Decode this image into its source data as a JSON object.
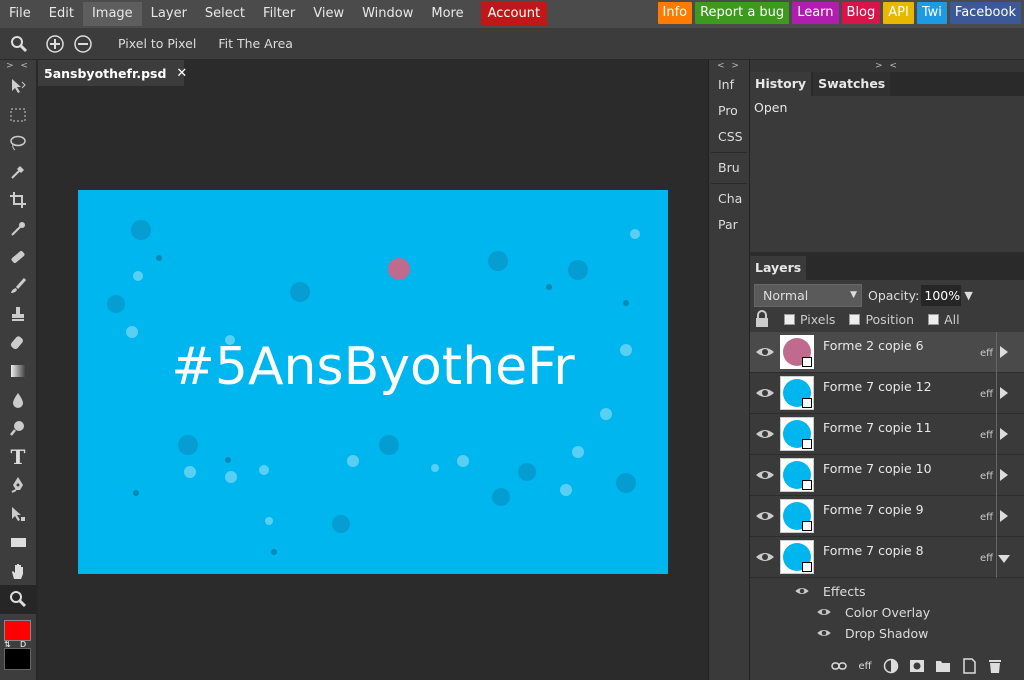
{
  "menubar": {
    "items": [
      "File",
      "Edit",
      "Image",
      "Layer",
      "Select",
      "Filter",
      "View",
      "Window",
      "More"
    ],
    "account": "Account",
    "badges": [
      {
        "label": "Info",
        "color": "#ff7a00"
      },
      {
        "label": "Report a bug",
        "color": "#3d9a1f"
      },
      {
        "label": "Learn",
        "color": "#b01eb0"
      },
      {
        "label": "Blog",
        "color": "#d8154a"
      },
      {
        "label": "API",
        "color": "#e8b800"
      },
      {
        "label": "Twi",
        "color": "#1c9be3"
      },
      {
        "label": "Facebook",
        "color": "#3b5998"
      }
    ]
  },
  "options": {
    "pixel_to_pixel": "Pixel to Pixel",
    "fit_area": "Fit The Area"
  },
  "toolbar": {
    "collapse": "> <",
    "swap": "⇅",
    "default": "D"
  },
  "document": {
    "tab_title": "5ansbyothefr.psd",
    "close": "✕",
    "headline": "#5AnsByotheFr",
    "canvas_color": "#00b6ee"
  },
  "midpanel": {
    "collapse": "< >",
    "items": [
      "Inf",
      "Pro",
      "CSS",
      "Bru",
      "Cha",
      "Par"
    ]
  },
  "history": {
    "collapse": "> <",
    "tabs": [
      "History",
      "Swatches"
    ],
    "entries": [
      "Open"
    ]
  },
  "layers": {
    "tab": "Layers",
    "blend_mode": "Normal",
    "opacity_label": "Opacity:",
    "opacity_value": "100%",
    "lock_options": [
      "Pixels",
      "Position",
      "All"
    ],
    "rows": [
      {
        "name": "Forme 2 copie 6",
        "color": "#c06b8e"
      },
      {
        "name": "Forme 7 copie 12",
        "color": "#00b6ee"
      },
      {
        "name": "Forme 7 copie 11",
        "color": "#00b6ee"
      },
      {
        "name": "Forme 7 copie 10",
        "color": "#00b6ee"
      },
      {
        "name": "Forme 7 copie 9",
        "color": "#00b6ee"
      },
      {
        "name": "Forme 7 copie 8",
        "color": "#00b6ee"
      }
    ],
    "eff_label": "eff",
    "effects_label": "Effects",
    "effects": [
      "Color Overlay",
      "Drop Shadow"
    ]
  }
}
